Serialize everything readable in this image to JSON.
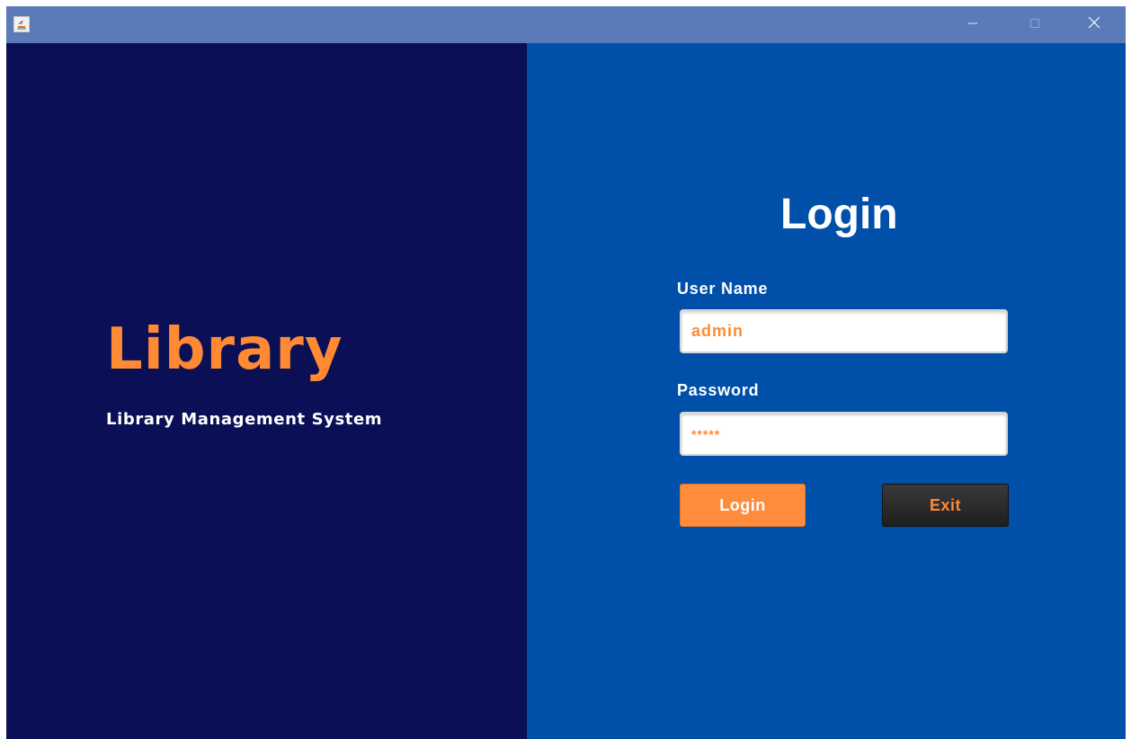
{
  "window": {
    "title": "",
    "controls": {
      "minimize": "minimize-icon",
      "maximize": "maximize-icon",
      "close": "close-icon"
    }
  },
  "left": {
    "title": "Library",
    "subtitle": "Library Management System"
  },
  "login": {
    "title": "Login",
    "username_label": "User Name",
    "username_value": "admin",
    "password_label": "Password",
    "password_value": "*****",
    "login_button": "Login",
    "exit_button": "Exit"
  },
  "colors": {
    "left_panel": "#0a0f56",
    "right_panel": "#004fa8",
    "accent": "#ff8a33",
    "titlebar": "#5a7ab8"
  }
}
